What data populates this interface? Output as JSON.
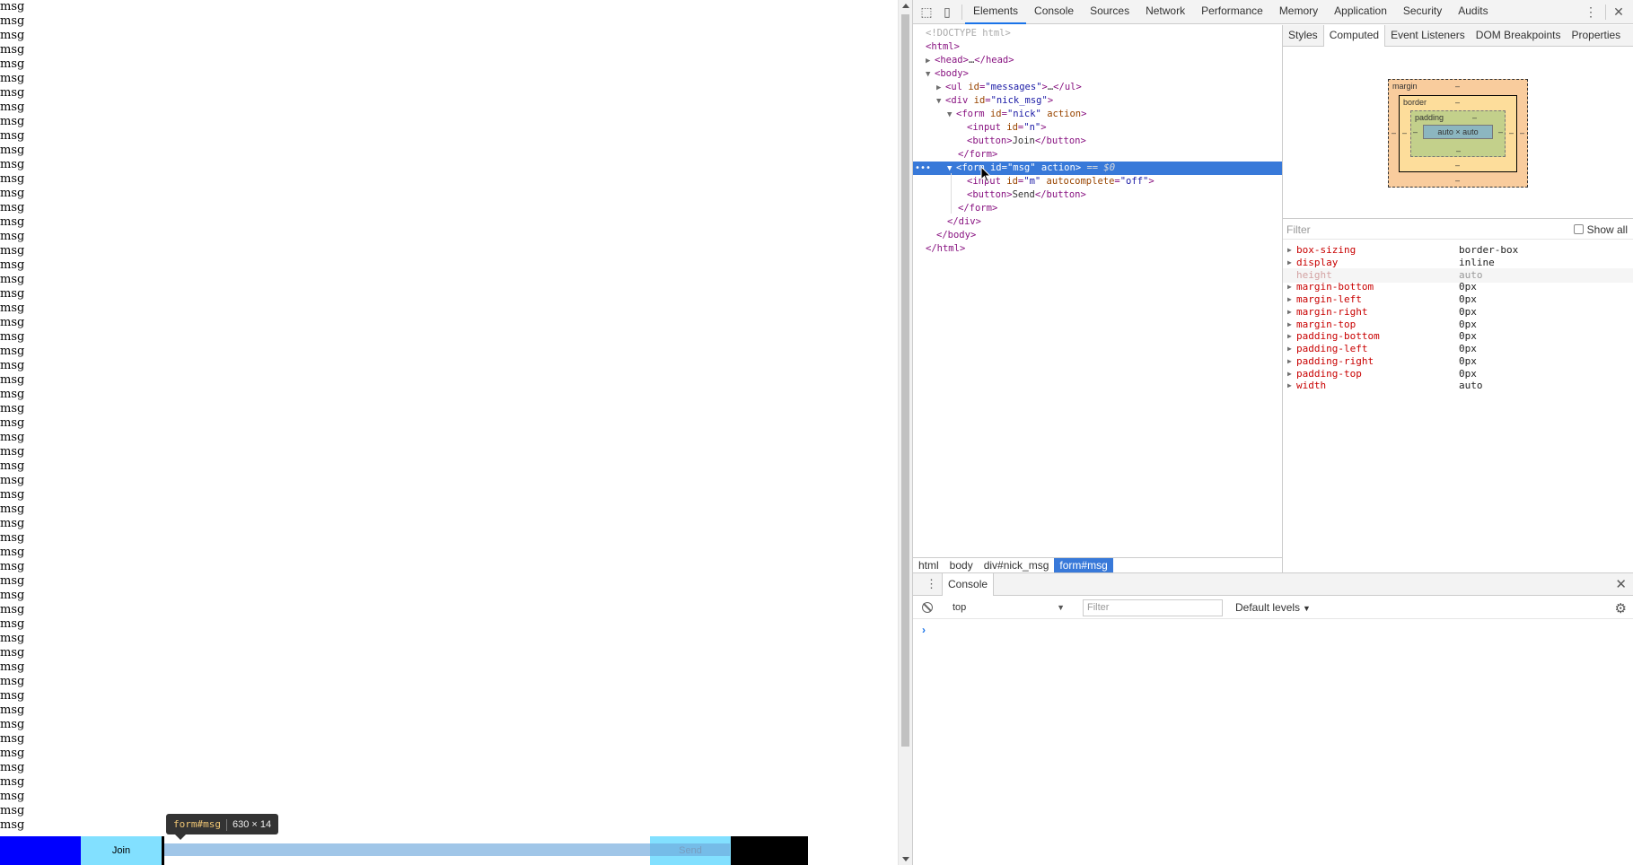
{
  "page": {
    "messages": [
      "msg",
      "msg",
      "msg",
      "msg",
      "msg",
      "msg",
      "msg",
      "msg",
      "msg",
      "msg",
      "msg",
      "msg",
      "msg",
      "msg",
      "msg",
      "msg",
      "msg",
      "msg",
      "msg",
      "msg",
      "msg",
      "msg",
      "msg",
      "msg",
      "msg",
      "msg",
      "msg",
      "msg",
      "msg",
      "msg",
      "msg",
      "msg",
      "msg",
      "msg",
      "msg",
      "msg",
      "msg",
      "msg",
      "msg",
      "msg",
      "msg",
      "msg",
      "msg",
      "msg",
      "msg",
      "msg",
      "msg",
      "msg",
      "msg",
      "msg",
      "msg",
      "msg",
      "msg",
      "msg",
      "msg",
      "msg",
      "msg",
      "msg"
    ],
    "join_label": "Join",
    "send_label": "Send",
    "tooltip_tag": "form#msg",
    "tooltip_dims": "630 × 14"
  },
  "devtools": {
    "tabs": [
      "Elements",
      "Console",
      "Sources",
      "Network",
      "Performance",
      "Memory",
      "Application",
      "Security",
      "Audits"
    ],
    "active_tab": "Elements",
    "dom": {
      "doctype": "<!DOCTYPE html>",
      "html_open": "html",
      "head_collapsed": "head",
      "head_ellipsis": "…",
      "body_open": "body",
      "ul_tag": "ul",
      "ul_id_attr": "id",
      "ul_id_val": "\"messages\"",
      "div_tag": "div",
      "div_id_val": "\"nick_msg\"",
      "form_tag": "form",
      "form1_id_val": "\"nick\"",
      "action_attr": "action",
      "input_tag": "input",
      "input1_id_val": "\"n\"",
      "button_tag": "button",
      "join_text": "Join",
      "form2_id_val": "\"msg\"",
      "selected_suffix": "== $0",
      "input2_id_val": "\"m\"",
      "autocomplete_attr": "autocomplete",
      "autocomplete_val": "\"off\"",
      "send_text": "Send"
    },
    "breadcrumbs": [
      "html",
      "body",
      "div#nick_msg",
      "form#msg"
    ],
    "side_tabs": [
      "Styles",
      "Computed",
      "Event Listeners",
      "DOM Breakpoints",
      "Properties"
    ],
    "active_side_tab": "Computed",
    "box_model": {
      "margin_label": "margin",
      "border_label": "border",
      "padding_label": "padding",
      "content": "auto × auto",
      "dash": "–"
    },
    "filter_placeholder": "Filter",
    "show_all_label": "Show all",
    "computed": [
      {
        "name": "box-sizing",
        "value": "border-box",
        "expandable": true
      },
      {
        "name": "display",
        "value": "inline",
        "expandable": true
      },
      {
        "name": "height",
        "value": "auto",
        "expandable": false
      },
      {
        "name": "margin-bottom",
        "value": "0px",
        "expandable": true
      },
      {
        "name": "margin-left",
        "value": "0px",
        "expandable": true
      },
      {
        "name": "margin-right",
        "value": "0px",
        "expandable": true
      },
      {
        "name": "margin-top",
        "value": "0px",
        "expandable": true
      },
      {
        "name": "padding-bottom",
        "value": "0px",
        "expandable": true
      },
      {
        "name": "padding-left",
        "value": "0px",
        "expandable": true
      },
      {
        "name": "padding-right",
        "value": "0px",
        "expandable": true
      },
      {
        "name": "padding-top",
        "value": "0px",
        "expandable": true
      },
      {
        "name": "width",
        "value": "auto",
        "expandable": true
      }
    ],
    "console": {
      "tab_label": "Console",
      "context": "top",
      "filter_placeholder": "Filter",
      "levels_label": "Default levels",
      "prompt": "›"
    }
  },
  "colors": {
    "selection": "#3879d9",
    "highlight": "#6fa8dc",
    "join_bg": "#82e0ff",
    "nick_input_bg": "#0000ff"
  }
}
